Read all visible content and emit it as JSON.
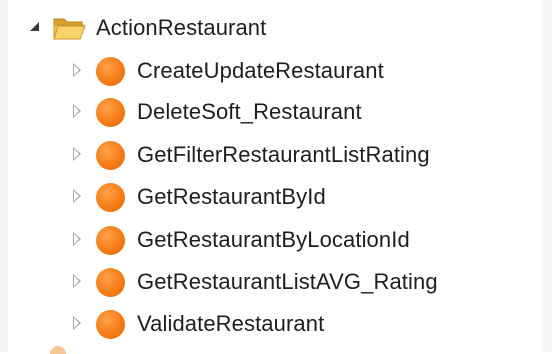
{
  "tree": {
    "root": {
      "label": "ActionRestaurant",
      "expanded": true,
      "icon": "folder-open-icon",
      "icon_color": "#e8b33a"
    },
    "children": [
      {
        "label": "CreateUpdateRestaurant",
        "icon": "action-circle-icon"
      },
      {
        "label": "DeleteSoft_Restaurant",
        "icon": "action-circle-icon"
      },
      {
        "label": "GetFilterRestaurantListRating",
        "icon": "action-circle-icon"
      },
      {
        "label": "GetRestaurantById",
        "icon": "action-circle-icon"
      },
      {
        "label": "GetRestaurantByLocationId",
        "icon": "action-circle-icon"
      },
      {
        "label": "GetRestaurantListAVG_Rating",
        "icon": "action-circle-icon"
      },
      {
        "label": "ValidateRestaurant",
        "icon": "action-circle-icon"
      }
    ],
    "action_icon_color": "#f57c16"
  }
}
